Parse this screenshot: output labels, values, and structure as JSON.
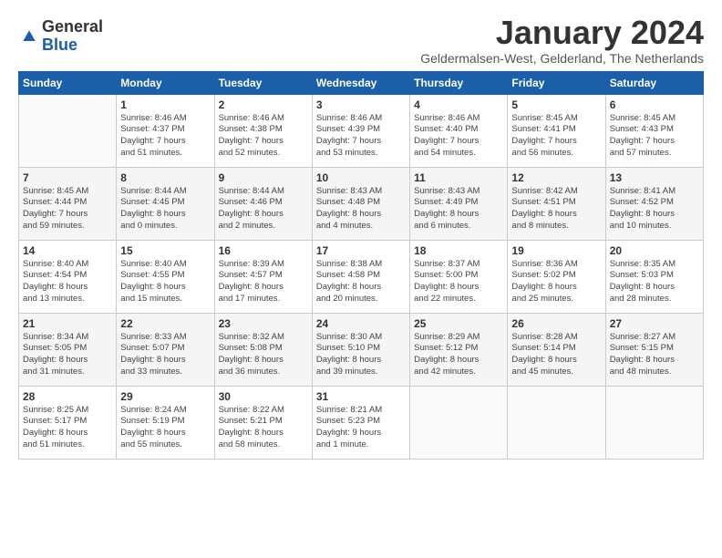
{
  "logo": {
    "general": "General",
    "blue": "Blue"
  },
  "title": "January 2024",
  "subtitle": "Geldermalsen-West, Gelderland, The Netherlands",
  "days_of_week": [
    "Sunday",
    "Monday",
    "Tuesday",
    "Wednesday",
    "Thursday",
    "Friday",
    "Saturday"
  ],
  "weeks": [
    [
      {
        "day": "",
        "content": ""
      },
      {
        "day": "1",
        "content": "Sunrise: 8:46 AM\nSunset: 4:37 PM\nDaylight: 7 hours\nand 51 minutes."
      },
      {
        "day": "2",
        "content": "Sunrise: 8:46 AM\nSunset: 4:38 PM\nDaylight: 7 hours\nand 52 minutes."
      },
      {
        "day": "3",
        "content": "Sunrise: 8:46 AM\nSunset: 4:39 PM\nDaylight: 7 hours\nand 53 minutes."
      },
      {
        "day": "4",
        "content": "Sunrise: 8:46 AM\nSunset: 4:40 PM\nDaylight: 7 hours\nand 54 minutes."
      },
      {
        "day": "5",
        "content": "Sunrise: 8:45 AM\nSunset: 4:41 PM\nDaylight: 7 hours\nand 56 minutes."
      },
      {
        "day": "6",
        "content": "Sunrise: 8:45 AM\nSunset: 4:43 PM\nDaylight: 7 hours\nand 57 minutes."
      }
    ],
    [
      {
        "day": "7",
        "content": "Sunrise: 8:45 AM\nSunset: 4:44 PM\nDaylight: 7 hours\nand 59 minutes."
      },
      {
        "day": "8",
        "content": "Sunrise: 8:44 AM\nSunset: 4:45 PM\nDaylight: 8 hours\nand 0 minutes."
      },
      {
        "day": "9",
        "content": "Sunrise: 8:44 AM\nSunset: 4:46 PM\nDaylight: 8 hours\nand 2 minutes."
      },
      {
        "day": "10",
        "content": "Sunrise: 8:43 AM\nSunset: 4:48 PM\nDaylight: 8 hours\nand 4 minutes."
      },
      {
        "day": "11",
        "content": "Sunrise: 8:43 AM\nSunset: 4:49 PM\nDaylight: 8 hours\nand 6 minutes."
      },
      {
        "day": "12",
        "content": "Sunrise: 8:42 AM\nSunset: 4:51 PM\nDaylight: 8 hours\nand 8 minutes."
      },
      {
        "day": "13",
        "content": "Sunrise: 8:41 AM\nSunset: 4:52 PM\nDaylight: 8 hours\nand 10 minutes."
      }
    ],
    [
      {
        "day": "14",
        "content": "Sunrise: 8:40 AM\nSunset: 4:54 PM\nDaylight: 8 hours\nand 13 minutes."
      },
      {
        "day": "15",
        "content": "Sunrise: 8:40 AM\nSunset: 4:55 PM\nDaylight: 8 hours\nand 15 minutes."
      },
      {
        "day": "16",
        "content": "Sunrise: 8:39 AM\nSunset: 4:57 PM\nDaylight: 8 hours\nand 17 minutes."
      },
      {
        "day": "17",
        "content": "Sunrise: 8:38 AM\nSunset: 4:58 PM\nDaylight: 8 hours\nand 20 minutes."
      },
      {
        "day": "18",
        "content": "Sunrise: 8:37 AM\nSunset: 5:00 PM\nDaylight: 8 hours\nand 22 minutes."
      },
      {
        "day": "19",
        "content": "Sunrise: 8:36 AM\nSunset: 5:02 PM\nDaylight: 8 hours\nand 25 minutes."
      },
      {
        "day": "20",
        "content": "Sunrise: 8:35 AM\nSunset: 5:03 PM\nDaylight: 8 hours\nand 28 minutes."
      }
    ],
    [
      {
        "day": "21",
        "content": "Sunrise: 8:34 AM\nSunset: 5:05 PM\nDaylight: 8 hours\nand 31 minutes."
      },
      {
        "day": "22",
        "content": "Sunrise: 8:33 AM\nSunset: 5:07 PM\nDaylight: 8 hours\nand 33 minutes."
      },
      {
        "day": "23",
        "content": "Sunrise: 8:32 AM\nSunset: 5:08 PM\nDaylight: 8 hours\nand 36 minutes."
      },
      {
        "day": "24",
        "content": "Sunrise: 8:30 AM\nSunset: 5:10 PM\nDaylight: 8 hours\nand 39 minutes."
      },
      {
        "day": "25",
        "content": "Sunrise: 8:29 AM\nSunset: 5:12 PM\nDaylight: 8 hours\nand 42 minutes."
      },
      {
        "day": "26",
        "content": "Sunrise: 8:28 AM\nSunset: 5:14 PM\nDaylight: 8 hours\nand 45 minutes."
      },
      {
        "day": "27",
        "content": "Sunrise: 8:27 AM\nSunset: 5:15 PM\nDaylight: 8 hours\nand 48 minutes."
      }
    ],
    [
      {
        "day": "28",
        "content": "Sunrise: 8:25 AM\nSunset: 5:17 PM\nDaylight: 8 hours\nand 51 minutes."
      },
      {
        "day": "29",
        "content": "Sunrise: 8:24 AM\nSunset: 5:19 PM\nDaylight: 8 hours\nand 55 minutes."
      },
      {
        "day": "30",
        "content": "Sunrise: 8:22 AM\nSunset: 5:21 PM\nDaylight: 8 hours\nand 58 minutes."
      },
      {
        "day": "31",
        "content": "Sunrise: 8:21 AM\nSunset: 5:23 PM\nDaylight: 9 hours\nand 1 minute."
      },
      {
        "day": "",
        "content": ""
      },
      {
        "day": "",
        "content": ""
      },
      {
        "day": "",
        "content": ""
      }
    ]
  ]
}
